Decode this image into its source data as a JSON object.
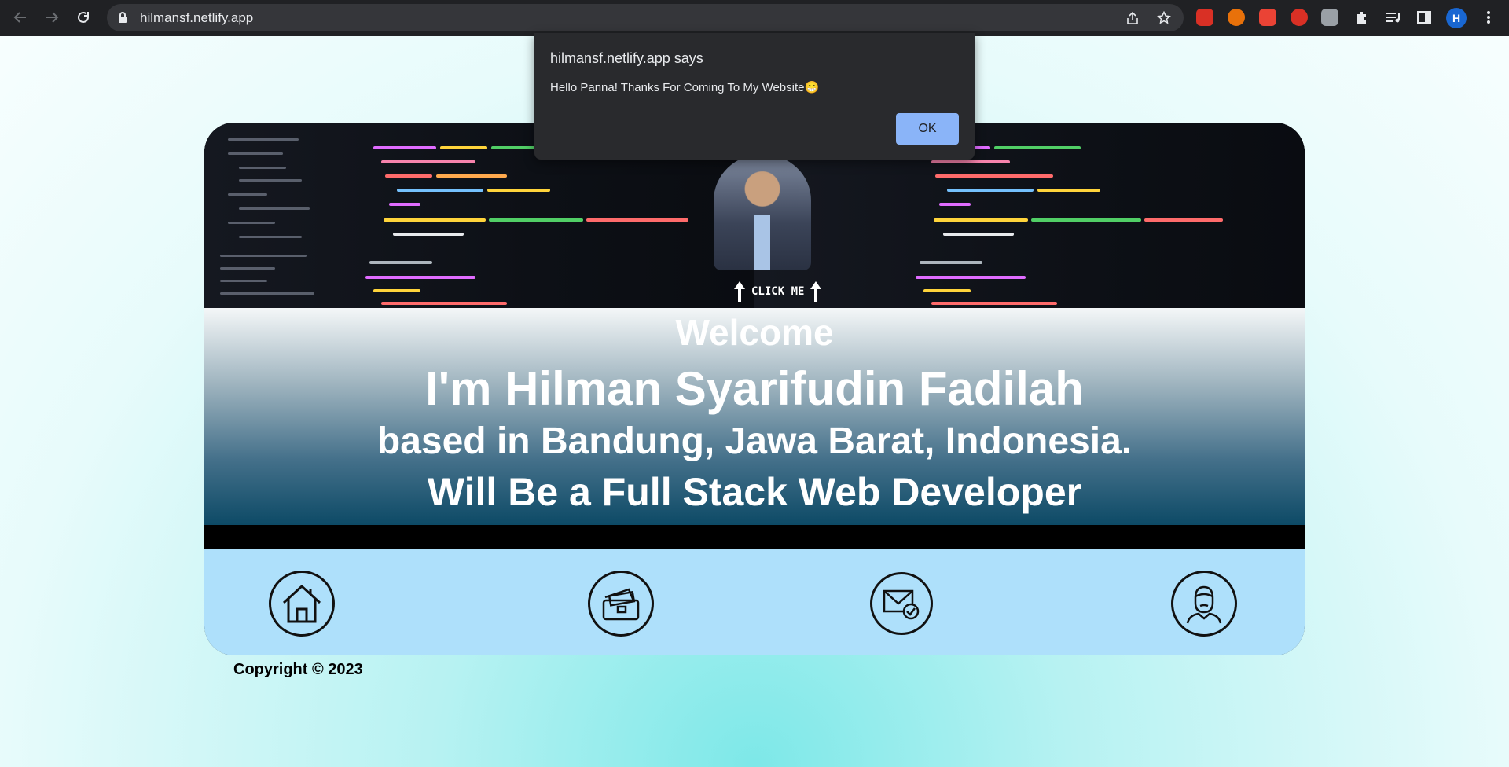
{
  "browser": {
    "url": "hilmansf.netlify.app",
    "profile_initial": "H",
    "extensions": [
      {
        "name": "chat-extension-icon",
        "color": "#d93025"
      },
      {
        "name": "hand-extension-icon",
        "color": "#e8710a"
      },
      {
        "name": "record-extension-icon",
        "color": "#ea4335"
      },
      {
        "name": "shield-extension-icon",
        "color": "#d93025"
      },
      {
        "name": "grey-extension-icon",
        "color": "#9aa0a6"
      }
    ]
  },
  "hero": {
    "click_label": "CLICK ME"
  },
  "welcome": {
    "line1": "Welcome",
    "line2": "I'm Hilman Syarifudin Fadilah",
    "line3": "based in Bandung, Jawa Barat, Indonesia.",
    "line4": "Will Be a Full Stack Web Developer"
  },
  "nav": [
    {
      "name": "home-icon"
    },
    {
      "name": "portfolio-wallet-icon"
    },
    {
      "name": "contact-mail-icon"
    },
    {
      "name": "about-profile-icon"
    }
  ],
  "footer": {
    "copyright": "Copyright © 2023"
  },
  "dialog": {
    "title": "hilmansf.netlify.app says",
    "message": "Hello Panna! Thanks For Coming To My Website😁",
    "ok_label": "OK"
  },
  "colors": {
    "browser_bar": "#202124",
    "nav_band": "#aee0fb",
    "dialog_button": "#8ab4f8"
  }
}
